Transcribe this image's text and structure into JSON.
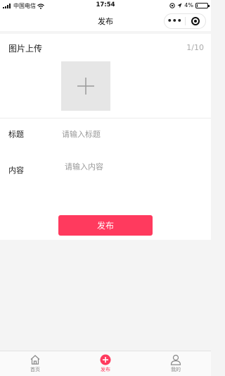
{
  "status_bar": {
    "carrier": "中国电信",
    "time": "17:54",
    "battery": "4%",
    "battery_level": 0.04
  },
  "nav": {
    "title": "发布",
    "more_icon": "ellipsis-icon",
    "close_icon": "target-icon"
  },
  "upload": {
    "title": "图片上传",
    "counter": "1/10",
    "add_icon": "plus-icon"
  },
  "form": {
    "title_label": "标题",
    "title_placeholder": "请输入标题",
    "content_label": "内容",
    "content_placeholder": "请输入内容",
    "submit_label": "发布"
  },
  "tabbar": {
    "items": [
      {
        "label": "首页",
        "icon": "home-icon",
        "active": false
      },
      {
        "label": "发布",
        "icon": "plus-circle-icon",
        "active": true
      },
      {
        "label": "我的",
        "icon": "user-icon",
        "active": false
      }
    ]
  },
  "colors": {
    "accent": "#ff3a5e",
    "background": "#f4f4f4"
  }
}
